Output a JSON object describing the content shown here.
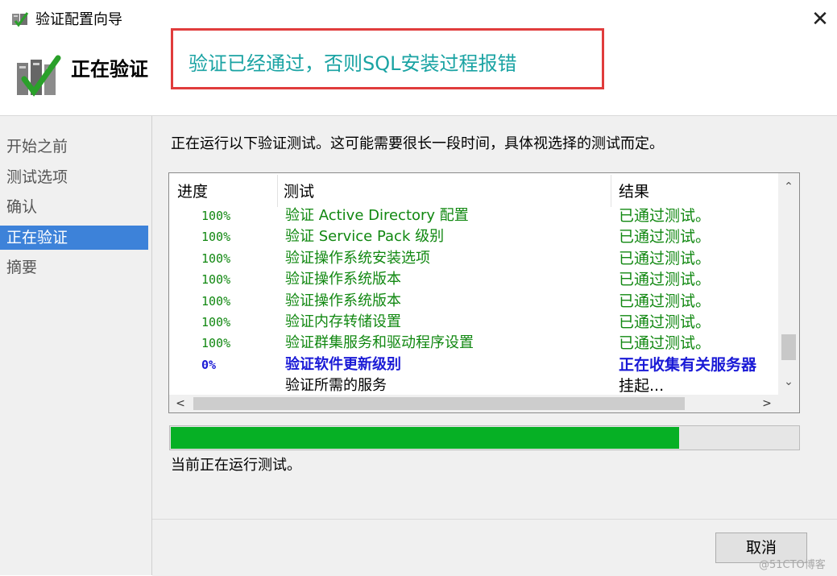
{
  "window": {
    "title": "验证配置向导"
  },
  "header": {
    "title": "正在验证"
  },
  "annotation": {
    "text": "验证已经通过，否则SQL安装过程报错",
    "color": "#1aa3a3",
    "border_color": "#e03c3c"
  },
  "sidebar": {
    "items": [
      {
        "label": "开始之前",
        "active": false
      },
      {
        "label": "测试选项",
        "active": false
      },
      {
        "label": "确认",
        "active": false
      },
      {
        "label": "正在验证",
        "active": true
      },
      {
        "label": "摘要",
        "active": false
      }
    ]
  },
  "main": {
    "description": "正在运行以下验证测试。这可能需要很长一段时间，具体视选择的测试而定。",
    "columns": [
      "进度",
      "测试",
      "结果"
    ],
    "rows": [
      {
        "progress": "100%",
        "test": "验证 Active Directory 配置",
        "result": "已通过测试。",
        "state": "passed"
      },
      {
        "progress": "100%",
        "test": "验证 Service Pack 级别",
        "result": "已通过测试。",
        "state": "passed"
      },
      {
        "progress": "100%",
        "test": "验证操作系统安装选项",
        "result": "已通过测试。",
        "state": "passed"
      },
      {
        "progress": "100%",
        "test": "验证操作系统版本",
        "result": "已通过测试。",
        "state": "passed"
      },
      {
        "progress": "100%",
        "test": "验证操作系统版本",
        "result": "已通过测试。",
        "state": "passed"
      },
      {
        "progress": "100%",
        "test": "验证内存转储设置",
        "result": "已通过测试。",
        "state": "passed"
      },
      {
        "progress": "100%",
        "test": "验证群集服务和驱动程序设置",
        "result": "已通过测试。",
        "state": "passed"
      },
      {
        "progress": "0%",
        "test": "验证软件更新级别",
        "result": "正在收集有关服务器",
        "state": "running"
      },
      {
        "progress": "",
        "test": "验证所需的服务",
        "result": "挂起...",
        "state": "pending"
      }
    ],
    "progress_percent": 81,
    "status": "当前正在运行测试。"
  },
  "footer": {
    "cancel_label": "取消"
  },
  "watermark": "@51CTO博客",
  "colors": {
    "passed": "#118811",
    "running": "#1a1ad6",
    "pending": "#000000",
    "progress_fill": "#06b025",
    "sidebar_active": "#3d82d9"
  }
}
